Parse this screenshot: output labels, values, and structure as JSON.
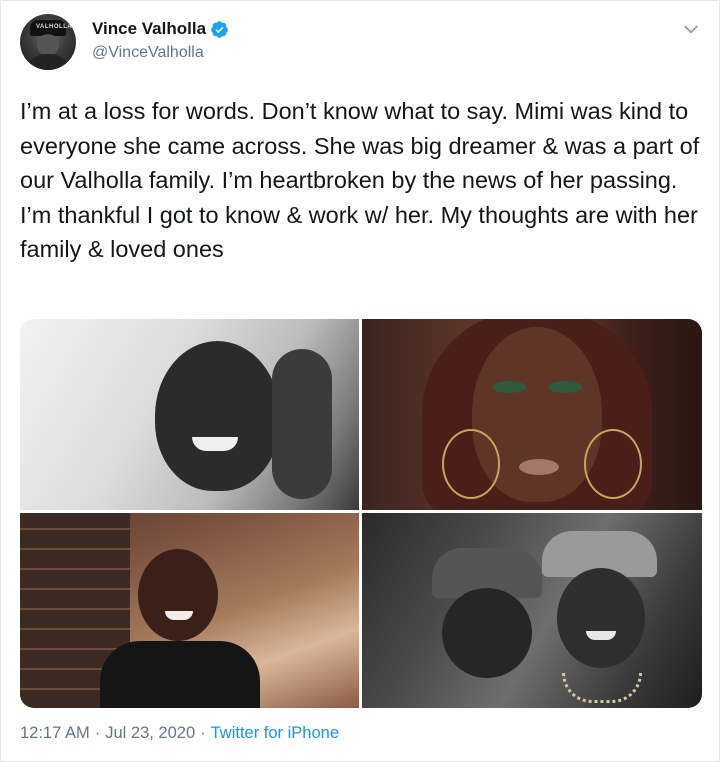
{
  "author": {
    "display_name": "Vince Valholla",
    "handle": "@VinceValholla",
    "avatar_cap_text": "VALHOLLA",
    "verified": true
  },
  "tweet": {
    "text": "I’m at a loss for words. Don’t know what to say. Mimi was kind to everyone she came across. She was big dreamer & was a part of our Valholla family. I’m heartbroken by the news of her passing. I’m thankful I got to know & work w/  her. My thoughts are with her family & loved ones"
  },
  "media": {
    "count": 4,
    "photos": [
      {
        "icon": "photo-woman-laughing-bw"
      },
      {
        "icon": "photo-woman-selfie-green-eyeshadow"
      },
      {
        "icon": "photo-woman-smiling-brick-wall"
      },
      {
        "icon": "photo-two-people-caps"
      }
    ]
  },
  "meta": {
    "time": "12:17 AM",
    "separator1": "·",
    "date": "Jul 23, 2020",
    "separator2": "·",
    "source": "Twitter for iPhone"
  },
  "colors": {
    "text": "#14171a",
    "secondary": "#657786",
    "link": "#1b95e0",
    "verified": "#1da1f2",
    "border": "#e1e8ed"
  },
  "icons": {
    "verified": "verified-badge-icon",
    "menu": "chevron-down-icon"
  }
}
